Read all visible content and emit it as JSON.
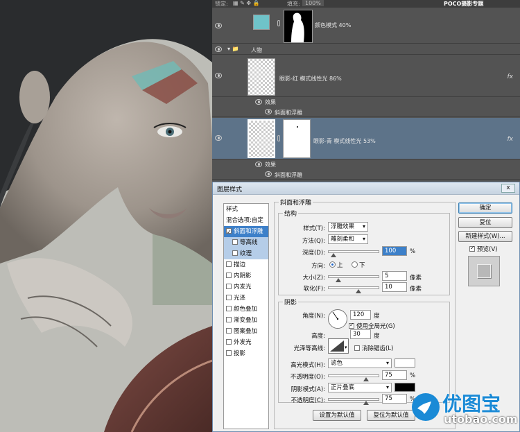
{
  "layers_panel": {
    "topbar": {
      "lock_label": "锁定:",
      "fill_label": "填充:",
      "fill_value": "100%",
      "watermark": "POCO摄影专题"
    },
    "layers": [
      {
        "name": "颜色模式 40%",
        "thumb_color": "#6fc3c9"
      },
      {
        "name": "人物",
        "kind": "group"
      },
      {
        "name": "眼影-红 模式线性光 86%",
        "fx": "fx"
      },
      {
        "name": "效果",
        "kind": "effects"
      },
      {
        "name": "斜面和浮雕",
        "kind": "effect"
      },
      {
        "name": "眼影-青 模式线性光 53%",
        "fx": "fx",
        "selected": true
      },
      {
        "name": "效果",
        "kind": "effects"
      },
      {
        "name": "斜面和浮雕",
        "kind": "effect"
      }
    ]
  },
  "dialog": {
    "title": "图层样式",
    "close_label": "x",
    "style_list": {
      "header": "样式",
      "items": [
        {
          "label": "混合选项:自定",
          "checkbox": false
        },
        {
          "label": "斜面和浮雕",
          "checkbox": true,
          "checked": true,
          "selected": true
        },
        {
          "label": "等高线",
          "checkbox": true,
          "checked": false,
          "indent": true,
          "sub": true
        },
        {
          "label": "纹理",
          "checkbox": true,
          "checked": false,
          "indent": true,
          "sub": true
        },
        {
          "label": "描边",
          "checkbox": true,
          "checked": false
        },
        {
          "label": "内阴影",
          "checkbox": true,
          "checked": false
        },
        {
          "label": "内发光",
          "checkbox": true,
          "checked": false
        },
        {
          "label": "光泽",
          "checkbox": true,
          "checked": false
        },
        {
          "label": "颜色叠加",
          "checkbox": true,
          "checked": false
        },
        {
          "label": "渐变叠加",
          "checkbox": true,
          "checked": false
        },
        {
          "label": "图案叠加",
          "checkbox": true,
          "checked": false
        },
        {
          "label": "外发光",
          "checkbox": true,
          "checked": false
        },
        {
          "label": "投影",
          "checkbox": true,
          "checked": false
        }
      ]
    },
    "bevel": {
      "title": "斜面和浮雕",
      "structure": {
        "title": "结构",
        "style_label": "样式(T):",
        "style_value": "浮雕效果",
        "technique_label": "方法(Q):",
        "technique_value": "雕刻柔和",
        "depth_label": "深度(D):",
        "depth_value": "100",
        "depth_unit": "%",
        "depth_fraction": 0.1,
        "direction_label": "方向:",
        "dir_up": "上",
        "dir_down": "下",
        "size_label": "大小(Z):",
        "size_value": "5",
        "size_unit": "像素",
        "size_fraction": 0.2,
        "soften_label": "软化(F):",
        "soften_value": "10",
        "soften_unit": "像素",
        "soften_fraction": 0.6
      },
      "shading": {
        "title": "阴影",
        "angle_label": "角度(N):",
        "angle_value": "120",
        "angle_unit": "度",
        "global_light_label": "使用全局光(G)",
        "altitude_label": "高度:",
        "altitude_value": "30",
        "altitude_unit": "度",
        "gloss_label": "光泽等高线:",
        "antialias_label": "消除锯齿(L)",
        "highlight_mode_label": "高光模式(H):",
        "highlight_mode_value": "滤色",
        "highlight_color": "#ffffff",
        "opacity1_label": "不透明度(O):",
        "opacity1_value": "75",
        "opacity1_unit": "%",
        "opacity1_fraction": 0.75,
        "shadow_mode_label": "阴影模式(A):",
        "shadow_mode_value": "正片叠底",
        "shadow_color": "#000000",
        "opacity2_label": "不透明度(C):",
        "opacity2_value": "75",
        "opacity2_unit": "%",
        "opacity2_fraction": 0.75
      },
      "reset_default_label": "设置为默认值",
      "restore_default_label": "复位为默认值"
    },
    "buttons": {
      "ok": "确定",
      "reset": "复位",
      "new_style": "新建样式(W)...",
      "preview": "预览(V)"
    }
  },
  "watermark": {
    "brand": "优图宝",
    "url": "utobao.com",
    "brand_color": "#1a8ad6"
  }
}
